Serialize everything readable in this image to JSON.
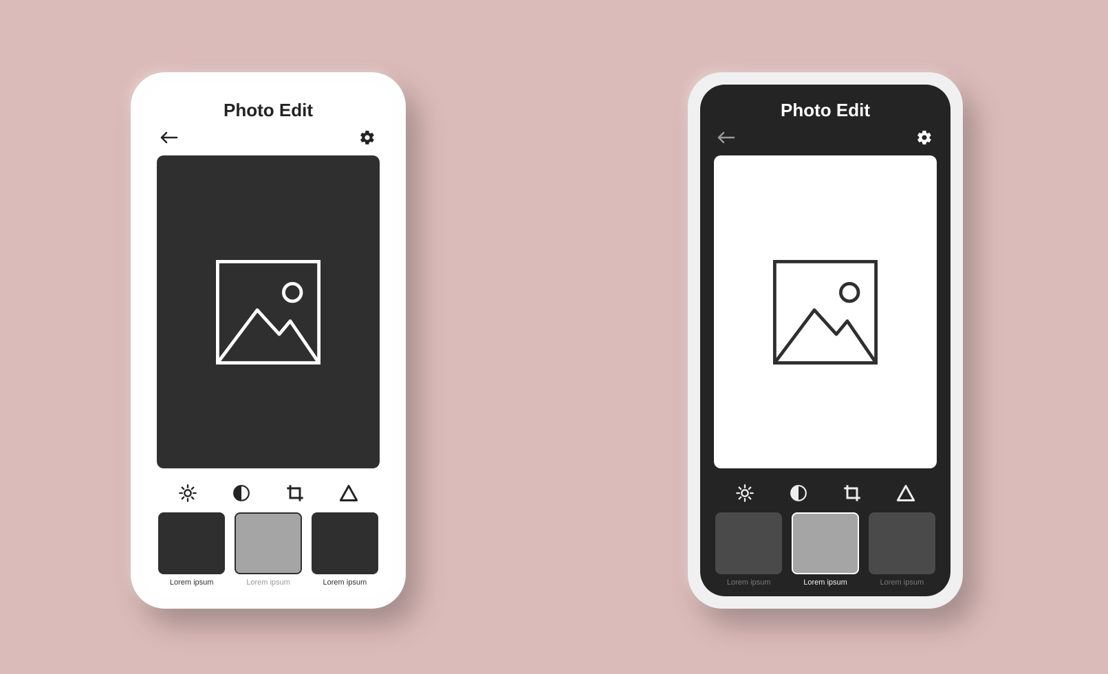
{
  "app": {
    "title": "Photo Edit"
  },
  "presets": [
    {
      "label": "Lorem ipsum",
      "selected": false
    },
    {
      "label": "Lorem ipsum",
      "selected": true
    },
    {
      "label": "Lorem ipsum",
      "selected": false
    }
  ],
  "tools": [
    "brightness",
    "contrast",
    "crop",
    "sharpen"
  ],
  "icons": {
    "back": "arrow-left-icon",
    "settings": "gear-icon",
    "placeholder": "image-placeholder-icon"
  },
  "themes": {
    "left": "light",
    "right": "dark"
  },
  "colors": {
    "page_bg": "#dbbbb9",
    "light_bg": "#ffffff",
    "dark_bg": "#242424",
    "canvas_dark": "#2f2f2f",
    "canvas_light": "#ffffff",
    "swatch_selected": "#a5a5a5"
  }
}
